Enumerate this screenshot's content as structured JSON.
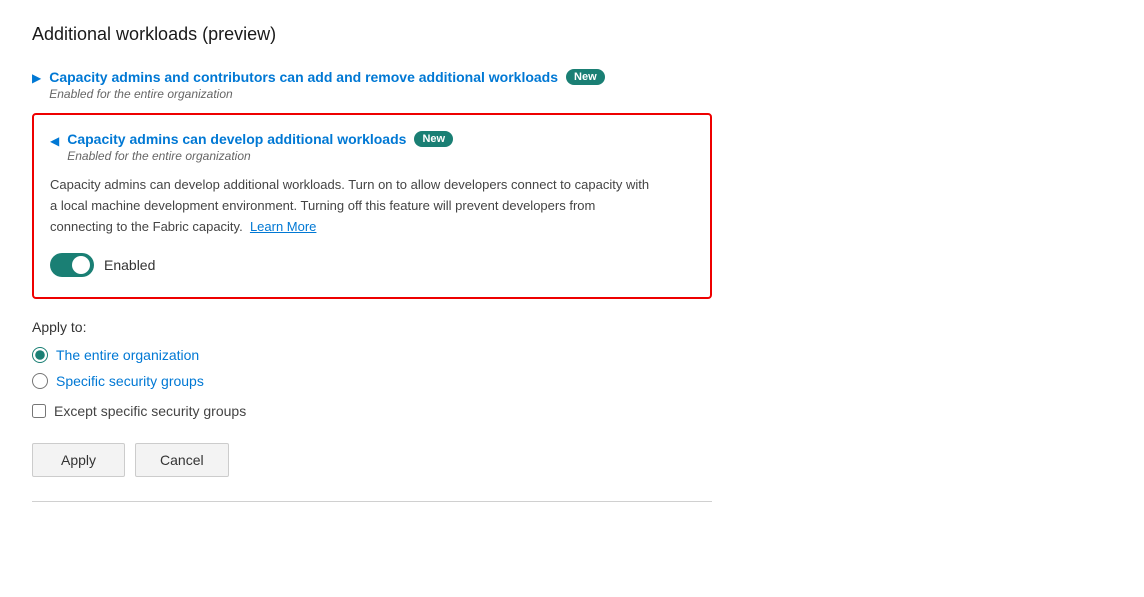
{
  "page": {
    "title": "Additional workloads (preview)"
  },
  "first_item": {
    "title": "Capacity admins and contributors can add and remove additional workloads",
    "badge": "New",
    "subtitle": "Enabled for the entire organization"
  },
  "expanded_item": {
    "title": "Capacity admins can develop additional workloads",
    "badge": "New",
    "subtitle": "Enabled for the entire organization",
    "description_part1": "Capacity admins can develop additional workloads. Turn on to allow developers connect to capacity with a local machine development environment. Turning off this feature will prevent developers from connecting to the Fabric capacity.",
    "learn_more_label": "Learn More",
    "toggle_label": "Enabled"
  },
  "apply_to": {
    "title": "Apply to:",
    "options": [
      {
        "label": "The entire organization",
        "value": "entire",
        "selected": true
      },
      {
        "label": "Specific security groups",
        "value": "specific",
        "selected": false
      }
    ],
    "checkbox_label": "Except specific security groups"
  },
  "buttons": {
    "apply_label": "Apply",
    "cancel_label": "Cancel"
  }
}
